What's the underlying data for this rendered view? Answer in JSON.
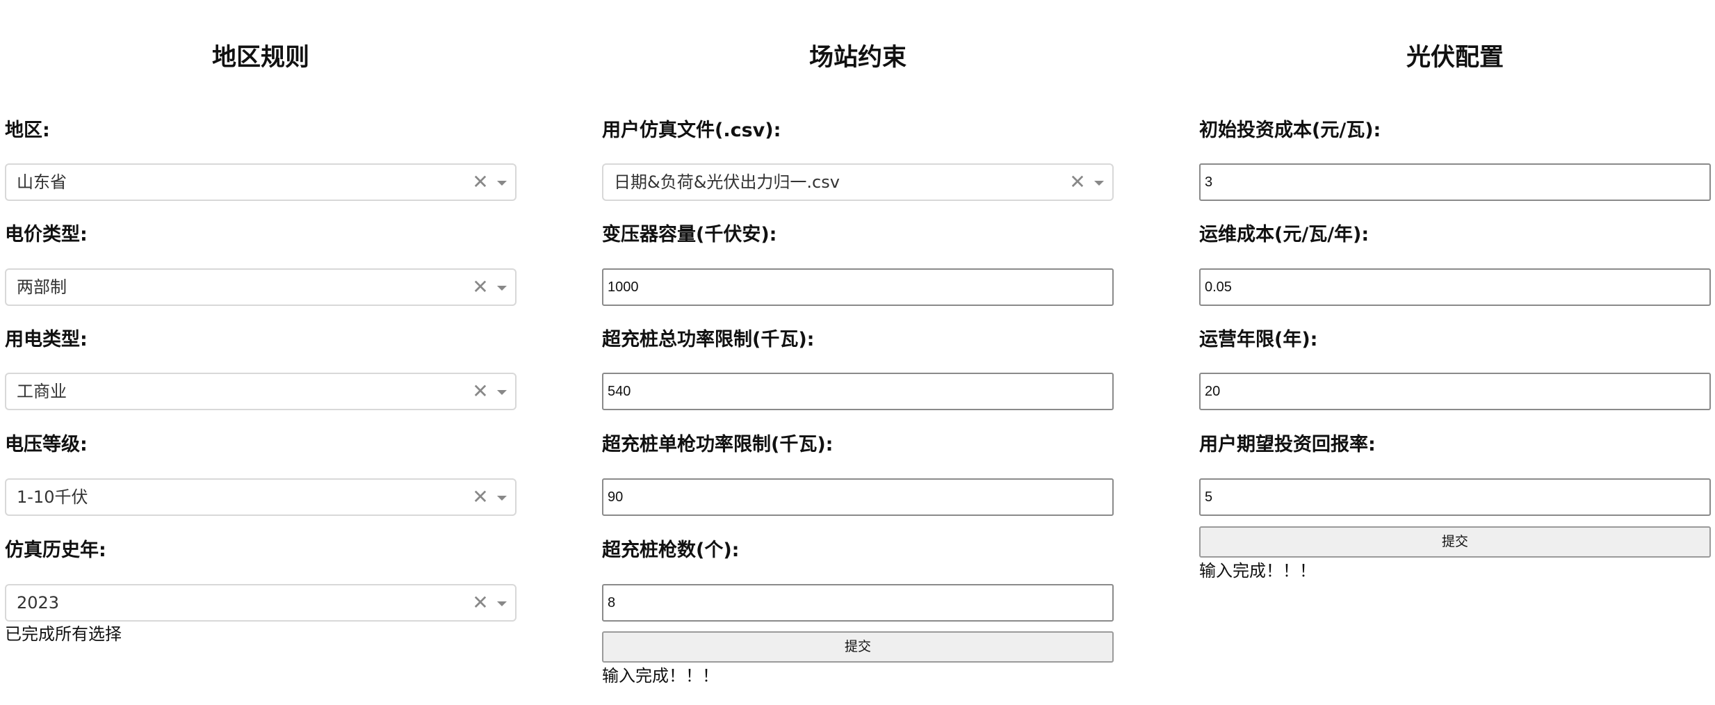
{
  "region": {
    "title": "地区规则",
    "fields": [
      {
        "label": "地区:",
        "value": "山东省"
      },
      {
        "label": "电价类型:",
        "value": "两部制"
      },
      {
        "label": "用电类型:",
        "value": "工商业"
      },
      {
        "label": "电压等级:",
        "value": "1-10千伏"
      },
      {
        "label": "仿真历史年:",
        "value": "2023"
      }
    ],
    "status": "已完成所有选择"
  },
  "station": {
    "title": "场站约束",
    "file": {
      "label": "用户仿真文件(.csv):",
      "value": "日期&负荷&光伏出力归一.csv"
    },
    "inputs": [
      {
        "label": "变压器容量(千伏安):",
        "value": "1000"
      },
      {
        "label": "超充桩总功率限制(千瓦):",
        "value": "540"
      },
      {
        "label": "超充桩单枪功率限制(千瓦):",
        "value": "90"
      },
      {
        "label": "超充桩枪数(个):",
        "value": "8"
      }
    ],
    "submit_label": "提交",
    "status": "输入完成！！！"
  },
  "pv": {
    "title": "光伏配置",
    "inputs": [
      {
        "label": "初始投资成本(元/瓦):",
        "value": "3"
      },
      {
        "label": "运维成本(元/瓦/年):",
        "value": "0.05"
      },
      {
        "label": "运营年限(年):",
        "value": "20"
      },
      {
        "label": "用户期望投资回报率:",
        "value": "5"
      }
    ],
    "submit_label": "提交",
    "status": "输入完成！！！"
  },
  "icons": {
    "clear": "close-icon",
    "dropdown": "chevron-down-icon"
  }
}
